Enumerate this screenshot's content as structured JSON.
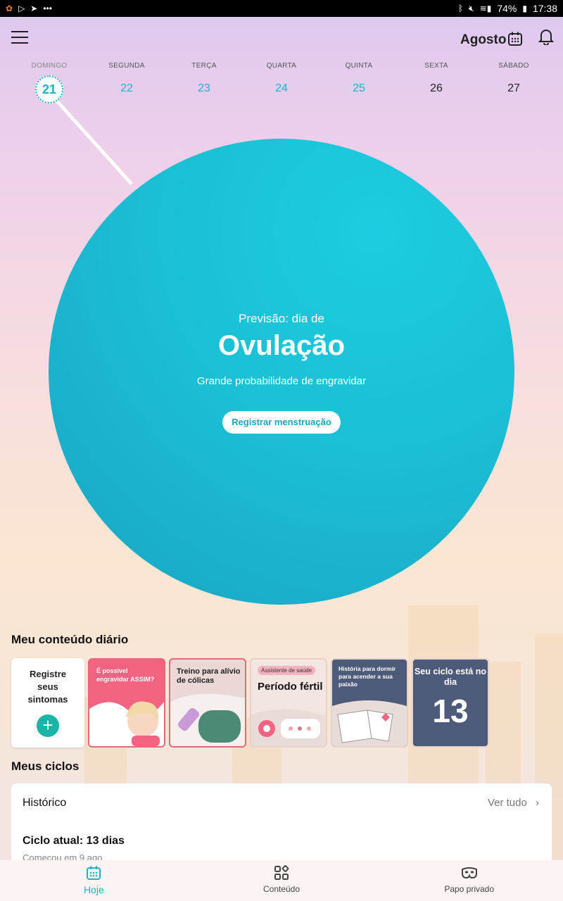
{
  "status_bar": {
    "battery": "74%",
    "time": "17:38"
  },
  "header": {
    "month": "Agosto"
  },
  "week": [
    {
      "name": "DOMINGO",
      "num": "21"
    },
    {
      "name": "SEGUNDA",
      "num": "22"
    },
    {
      "name": "TERÇA",
      "num": "23"
    },
    {
      "name": "QUARTA",
      "num": "24"
    },
    {
      "name": "QUINTA",
      "num": "25"
    },
    {
      "name": "SEXTA",
      "num": "26"
    },
    {
      "name": "SÁBADO",
      "num": "27"
    }
  ],
  "prediction": {
    "pre": "Previsão: dia de",
    "title": "Ovulação",
    "subtitle": "Grande probabilidade de engravidar",
    "button": "Registrar menstruação"
  },
  "daily": {
    "title": "Meu conteúdo diário",
    "register": "Registre seus sintomas",
    "cards": [
      {
        "text": "É possível engravidar ASSIM?"
      },
      {
        "text": "Treino para alívio de cólicas"
      },
      {
        "tag": "Assistente de saúde",
        "text": "Período fértil"
      },
      {
        "text": "História para dormir para acender a sua paixão"
      },
      {
        "text": "Seu ciclo está no dia",
        "day": "13"
      }
    ]
  },
  "cycles": {
    "title": "Meus ciclos",
    "history": "Histórico",
    "see_all": "Ver tudo",
    "current": "Ciclo atual: 13 dias",
    "started": "Começou em 9 ago"
  },
  "nav": {
    "today": "Hoje",
    "content": "Conteúdo",
    "private": "Papo privado"
  },
  "colors": {
    "accent": "#19b6c9",
    "circle": "#1bbfd3",
    "pink": "#f26382",
    "navy": "#4d5a7a"
  }
}
